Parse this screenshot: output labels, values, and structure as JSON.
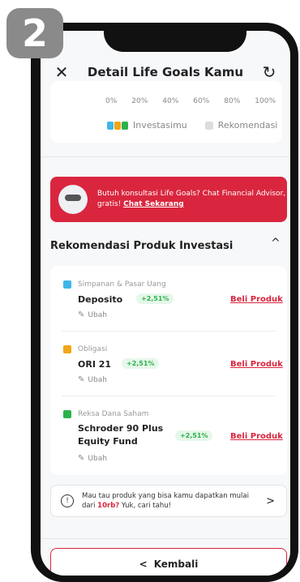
{
  "step_badge": "2",
  "header": {
    "close_icon": "✕",
    "title": "Detail Life Goals Kamu",
    "refresh_icon": "↻"
  },
  "chart": {
    "ticks": [
      "0%",
      "20%",
      "40%",
      "60%",
      "80%",
      "100%"
    ],
    "legend": [
      {
        "label": "Investasimu",
        "colors": [
          "#3fb6e8",
          "#f2a516",
          "#2bb24c"
        ]
      },
      {
        "label": "Rekomendasi",
        "color": "#dddddd"
      }
    ]
  },
  "banner": {
    "text": "Butuh konsultasi Life Goals? Chat Financial Advisor, gratis!",
    "link": "Chat Sekarang",
    "color": "#d9263e"
  },
  "section": {
    "title": "Rekomendasi Produk Investasi",
    "chevron_icon": "^"
  },
  "products": [
    {
      "category": "Simpanan & Pasar Uang",
      "color": "#3fb6e8",
      "name": "Deposito",
      "rate": "+2,51%",
      "buy": "Beli Produk",
      "edit": "Ubah"
    },
    {
      "category": "Obligasi",
      "color": "#f2a516",
      "name": "ORI 21",
      "rate": "+2,51%",
      "buy": "Beli Produk",
      "edit": "Ubah"
    },
    {
      "category": "Reksa Dana Saham",
      "color": "#2bb24c",
      "name": "Schroder 90 Plus Equity Fund",
      "rate": "+2,51%",
      "buy": "Beli Produk",
      "edit": "Ubah"
    }
  ],
  "info": {
    "text_before": "Mau tau produk yang bisa kamu dapatkan mulai dari ",
    "highlight": "10rb?",
    "text_after": " Yuk, cari tahu!",
    "chevron_icon": ">"
  },
  "back": {
    "chevron_icon": "<",
    "label": "Kembali"
  }
}
